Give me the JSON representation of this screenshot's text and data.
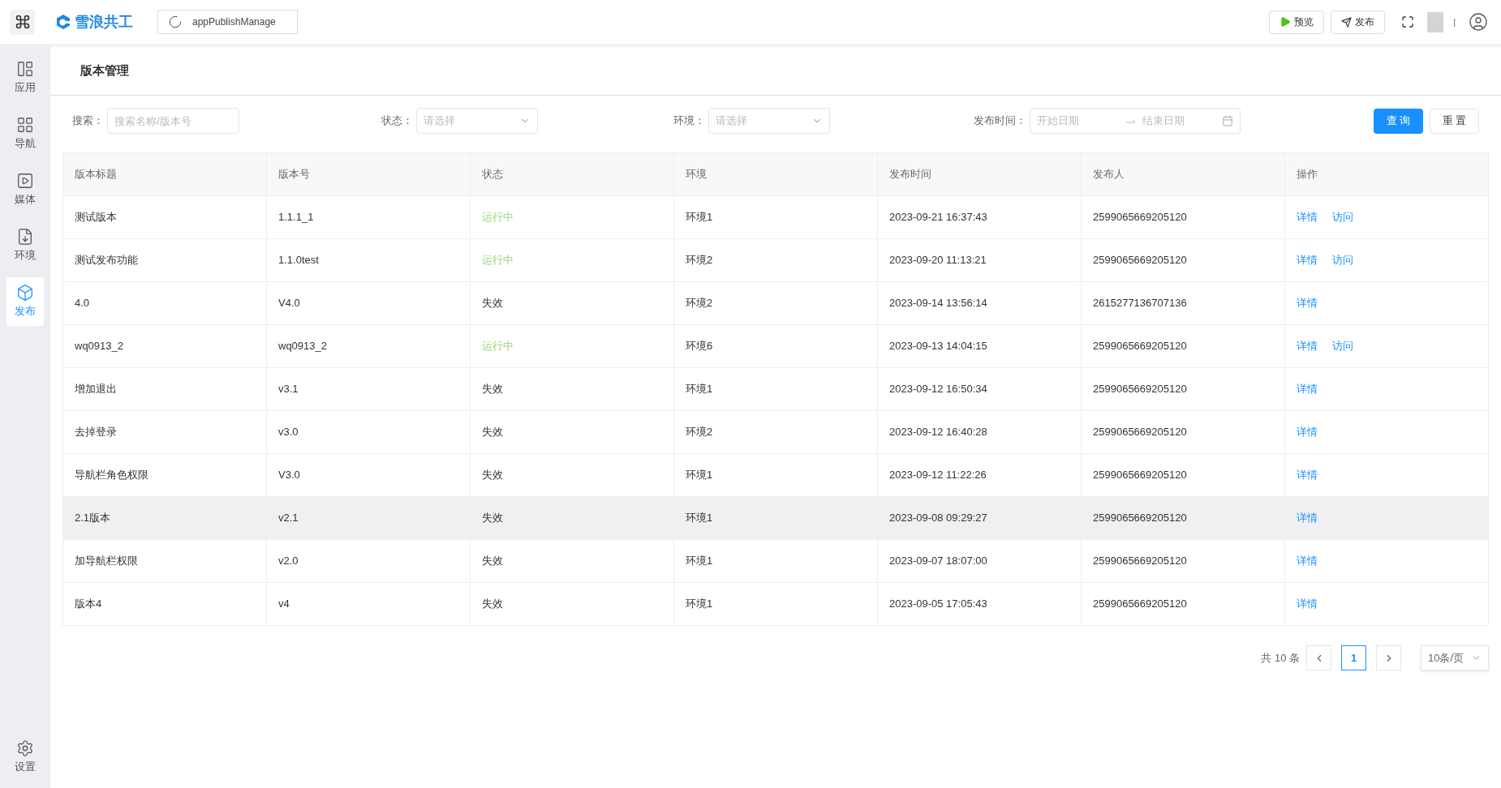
{
  "topbar": {
    "brand": "雪浪共工",
    "app_name": "appPublishManage",
    "buttons": [
      {
        "kind": "preview",
        "label": "预览"
      },
      {
        "kind": "publish",
        "label": "发布"
      }
    ],
    "divider": "|"
  },
  "sidebar": {
    "items": [
      {
        "kind": "app",
        "label": "应用",
        "selected": false
      },
      {
        "kind": "nav",
        "label": "导航",
        "selected": false
      },
      {
        "kind": "media",
        "label": "媒体",
        "selected": false
      },
      {
        "kind": "env",
        "label": "环境",
        "selected": false
      },
      {
        "kind": "publish",
        "label": "发布",
        "selected": true
      }
    ],
    "footer": {
      "kind": "settings",
      "label": "设置",
      "selected": false
    }
  },
  "page_title": "版本管理",
  "filters": {
    "search": {
      "label": "搜索：",
      "placeholder": "搜索名称/版本号"
    },
    "status": {
      "label": "状态：",
      "placeholder": "请选择"
    },
    "env": {
      "label": "环境：",
      "placeholder": "请选择"
    },
    "time": {
      "label": "发布时间：",
      "start_placeholder": "开始日期",
      "end_placeholder": "结束日期"
    },
    "query_button": "查 询",
    "reset_button": "重 置"
  },
  "table": {
    "columns": [
      "版本标题",
      "版本号",
      "状态",
      "环境",
      "发布时间",
      "发布人",
      "操作"
    ],
    "rows": [
      {
        "title": "测试版本",
        "version": "1.1.1_1",
        "status": "运行中",
        "color": "#95d475",
        "env": "环境1",
        "time": "2023-09-21 16:37:43",
        "publisher": "2599065669205120",
        "actions": [
          "详情",
          "访问"
        ],
        "selected": false
      },
      {
        "title": "测试发布功能",
        "version": "1.1.0test",
        "status": "运行中",
        "color": "#95d475",
        "env": "环境2",
        "time": "2023-09-20 11:13:21",
        "publisher": "2599065669205120",
        "actions": [
          "详情",
          "访问"
        ],
        "selected": false
      },
      {
        "title": "4.0",
        "version": "V4.0",
        "status": "失效",
        "color": "#333333",
        "env": "环境2",
        "time": "2023-09-14 13:56:14",
        "publisher": "2615277136707136",
        "actions": [
          "详情"
        ],
        "selected": false
      },
      {
        "title": "wq0913_2",
        "version": "wq0913_2",
        "status": "运行中",
        "color": "#95d475",
        "env": "环境6",
        "time": "2023-09-13 14:04:15",
        "publisher": "2599065669205120",
        "actions": [
          "详情",
          "访问"
        ],
        "selected": false
      },
      {
        "title": "增加退出",
        "version": "v3.1",
        "status": "失效",
        "color": "#333333",
        "env": "环境1",
        "time": "2023-09-12 16:50:34",
        "publisher": "2599065669205120",
        "actions": [
          "详情"
        ],
        "selected": false
      },
      {
        "title": "去掉登录",
        "version": "v3.0",
        "status": "失效",
        "color": "#333333",
        "env": "环境2",
        "time": "2023-09-12 16:40:28",
        "publisher": "2599065669205120",
        "actions": [
          "详情"
        ],
        "selected": false
      },
      {
        "title": "导航栏角色权限",
        "version": "V3.0",
        "status": "失效",
        "color": "#333333",
        "env": "环境1",
        "time": "2023-09-12 11:22:26",
        "publisher": "2599065669205120",
        "actions": [
          "详情"
        ],
        "selected": false
      },
      {
        "title": "2.1版本",
        "version": "v2.1",
        "status": "失效",
        "color": "#333333",
        "env": "环境1",
        "time": "2023-09-08 09:29:27",
        "publisher": "2599065669205120",
        "actions": [
          "详情"
        ],
        "selected": true
      },
      {
        "title": "加导航栏权限",
        "version": "v2.0",
        "status": "失效",
        "color": "#333333",
        "env": "环境1",
        "time": "2023-09-07 18:07:00",
        "publisher": "2599065669205120",
        "actions": [
          "详情"
        ],
        "selected": false
      },
      {
        "title": "版本4",
        "version": "v4",
        "status": "失效",
        "color": "#333333",
        "env": "环境1",
        "time": "2023-09-05 17:05:43",
        "publisher": "2599065669205120",
        "actions": [
          "详情"
        ],
        "selected": false
      }
    ]
  },
  "pagination": {
    "total": "共 10 条",
    "pages": [
      {
        "label": "1",
        "selected": true
      }
    ],
    "page_size": "10条/页"
  }
}
